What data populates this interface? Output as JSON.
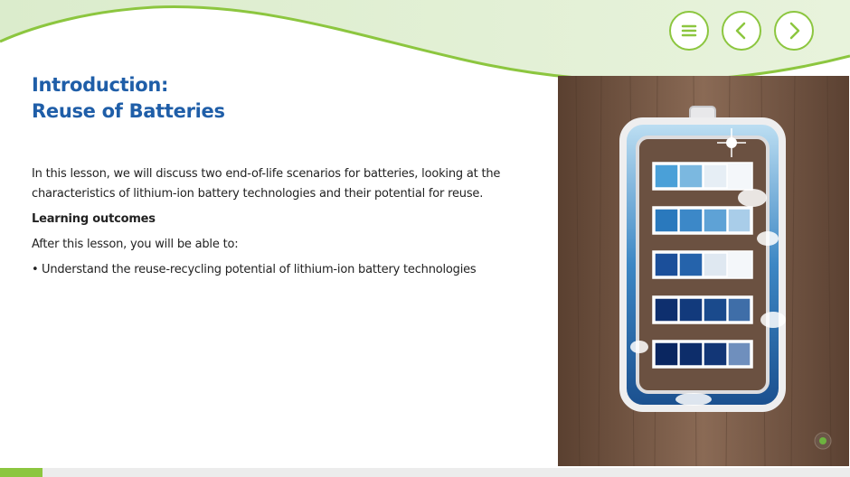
{
  "title": {
    "line1": "Introduction:",
    "line2": "Reuse of Batteries"
  },
  "intro": "In this lesson, we will discuss two end-of-life scenarios for batteries, looking at the characteristics of lithium-ion battery technologies and their potential for reuse.",
  "outcomes_heading": "Learning outcomes",
  "outcomes_lead": "After this lesson, you will be able to:",
  "outcomes": [
    "Understand the reuse-recycling potential of lithium-ion battery technologies"
  ],
  "nav": {
    "menu_icon": "menu-icon",
    "prev_icon": "chevron-left-icon",
    "next_icon": "chevron-right-icon"
  },
  "progress": {
    "fraction": 0.05
  },
  "colors": {
    "accent": "#8cc63f",
    "title": "#1f5ea8",
    "wave_light": "#e4f0d4"
  }
}
